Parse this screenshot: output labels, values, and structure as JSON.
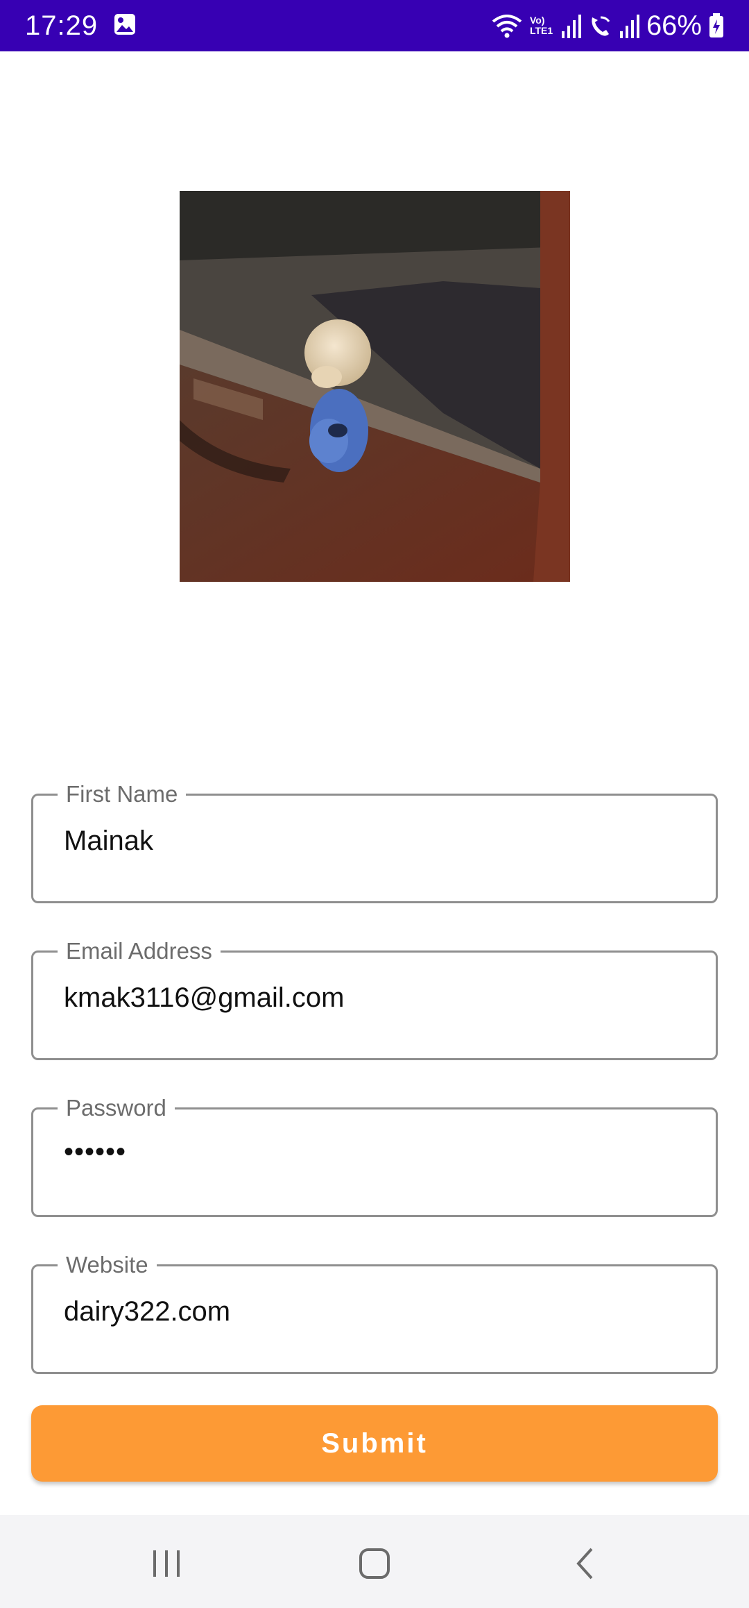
{
  "status_bar": {
    "time": "17:29",
    "network_label": "Vo) LTE1",
    "battery": "66%"
  },
  "profile_image": {
    "alt": "photo"
  },
  "form": {
    "first_name": {
      "label": "First Name",
      "value": "Mainak"
    },
    "email": {
      "label": "Email Address",
      "value": "kmak3116@gmail.com"
    },
    "password": {
      "label": "Password",
      "value": "••••••"
    },
    "website": {
      "label": "Website",
      "value": "dairy322.com"
    }
  },
  "submit_label": "Submit",
  "colors": {
    "status_bar": "#3700b3",
    "submit": "#fd9a35",
    "field_border": "#8f8f8f",
    "navbar": "#f4f4f6"
  },
  "nav_icons": [
    "recent-apps-icon",
    "home-icon",
    "back-icon"
  ]
}
